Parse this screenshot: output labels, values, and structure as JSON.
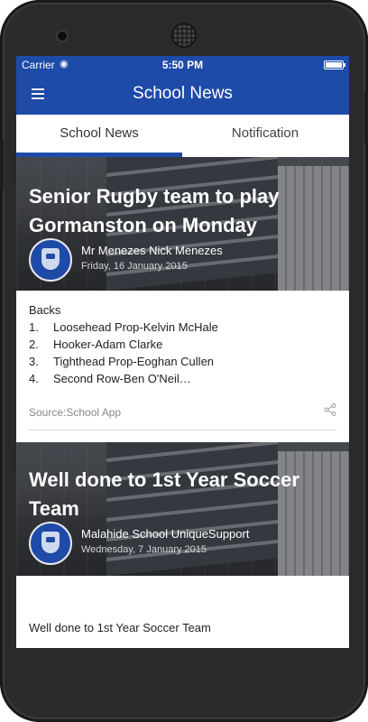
{
  "status_bar": {
    "carrier": "Carrier",
    "time": "5:50 PM"
  },
  "app_bar": {
    "title": "School News"
  },
  "tabs": [
    {
      "label": "School News",
      "selected": true
    },
    {
      "label": "Notification",
      "selected": false
    }
  ],
  "colors": {
    "primary": "#1e4aa8"
  },
  "news": [
    {
      "headline": "Senior Rugby team to play Gormanston on Monday",
      "author": "Mr Menezes Nick Menezes",
      "date": "Friday, 16 January 2015",
      "body_intro": "Backs",
      "body_items": [
        {
          "num": "1.",
          "text": "Loosehead Prop-Kelvin McHale"
        },
        {
          "num": "2.",
          "text": "Hooker-Adam Clarke"
        },
        {
          "num": "3.",
          "text": "Tighthead Prop-Eoghan Cullen"
        },
        {
          "num": "4.",
          "text": "Second Row-Ben O'Neil…"
        }
      ],
      "source": "Source:School App"
    },
    {
      "headline": "Well done to 1st Year Soccer Team",
      "author": "Malahide School UniqueSupport",
      "date": "Wednesday, 7 January 2015",
      "body_intro": "Well done to 1st Year Soccer Team"
    }
  ]
}
